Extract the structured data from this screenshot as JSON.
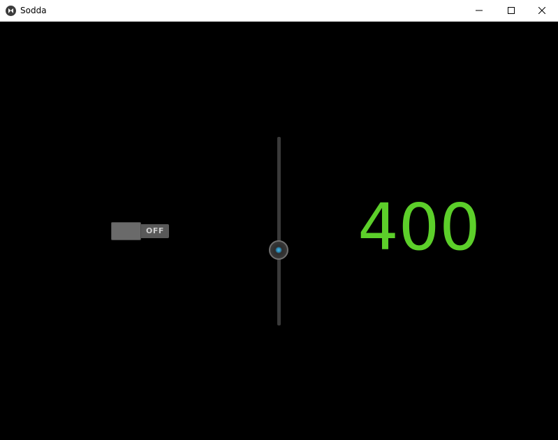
{
  "window": {
    "title": "Sodda",
    "icon": "kivy-app-icon",
    "controls": {
      "minimize_icon": "minimize-icon",
      "maximize_icon": "maximize-icon",
      "close_icon": "close-icon"
    }
  },
  "switch": {
    "state_label": "OFF",
    "active": false
  },
  "slider": {
    "orientation": "vertical",
    "level_fraction": 0.4
  },
  "display": {
    "value": "400",
    "color": "#5ccf2a"
  },
  "colors": {
    "background": "#000000",
    "accent": "#46b7e6"
  }
}
